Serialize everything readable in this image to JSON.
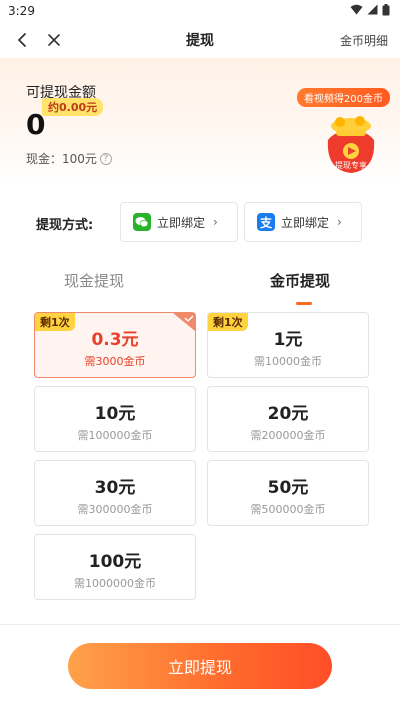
{
  "status_bar": {
    "time": "3:29"
  },
  "nav": {
    "title": "提现",
    "right_link": "金币明细"
  },
  "balance": {
    "label": "可提现金额",
    "approx": "约0.00元",
    "value": "0",
    "cash_line": "现金：100元"
  },
  "promo": {
    "video_badge": "看视频得200金币",
    "bag_label": "提现专享"
  },
  "method": {
    "label": "提现方式:",
    "wechat_bind": "立即绑定",
    "alipay_bind": "立即绑定",
    "alipay_glyph": "支"
  },
  "tabs": [
    {
      "label": "现金提现",
      "active": false
    },
    {
      "label": "金币提现",
      "active": true
    }
  ],
  "options": [
    {
      "amount": "0.3元",
      "need": "需3000金币",
      "tag": "剩1次",
      "selected": true
    },
    {
      "amount": "1元",
      "need": "需10000金币",
      "tag": "剩1次",
      "selected": false
    },
    {
      "amount": "10元",
      "need": "需100000金币",
      "tag": "",
      "selected": false
    },
    {
      "amount": "20元",
      "need": "需200000金币",
      "tag": "",
      "selected": false
    },
    {
      "amount": "30元",
      "need": "需300000金币",
      "tag": "",
      "selected": false
    },
    {
      "amount": "50元",
      "need": "需500000金币",
      "tag": "",
      "selected": false
    },
    {
      "amount": "100元",
      "need": "需1000000金币",
      "tag": "",
      "selected": false
    }
  ],
  "submit": {
    "label": "立即提现"
  },
  "colors": {
    "accent": "#ff6a1f",
    "selected_text": "#e8402a",
    "tag_bg": "#ffd23f"
  }
}
